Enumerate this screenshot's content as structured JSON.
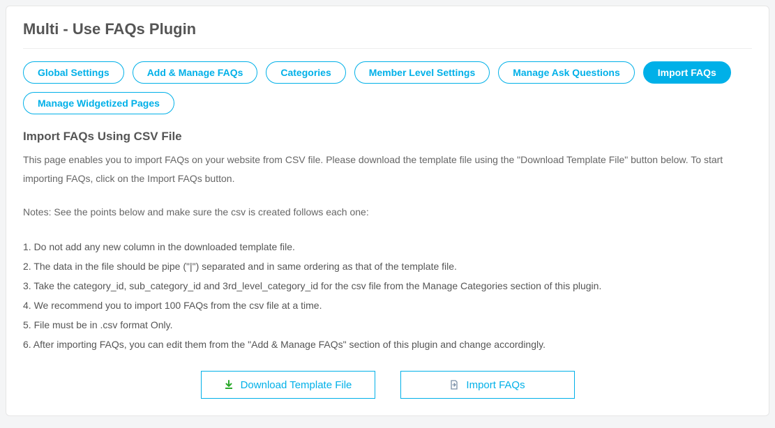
{
  "header": {
    "title": "Multi - Use FAQs Plugin"
  },
  "tabs": [
    {
      "label": "Global Settings",
      "active": false
    },
    {
      "label": "Add & Manage FAQs",
      "active": false
    },
    {
      "label": "Categories",
      "active": false
    },
    {
      "label": "Member Level Settings",
      "active": false
    },
    {
      "label": "Manage Ask Questions",
      "active": false
    },
    {
      "label": "Import FAQs",
      "active": true
    },
    {
      "label": "Manage Widgetized Pages",
      "active": false
    }
  ],
  "section": {
    "title": "Import FAQs Using CSV File",
    "description": "This page enables you to import FAQs on your website from CSV file. Please download the template file using the \"Download Template File\" button below. To start importing FAQs, click on the Import FAQs button.",
    "notes_intro": "Notes: See the points below and make sure the csv is created follows each one:",
    "points": [
      "Do not add any new column in the downloaded template file.",
      "The data in the file should be pipe (\"|\") separated and in same ordering as that of the template file.",
      "Take the category_id, sub_category_id and 3rd_level_category_id for the csv file from the Manage Categories section of this plugin.",
      "We recommend you to import 100 FAQs from the csv file at a time.",
      "File must be in .csv format Only.",
      "After importing FAQs, you can edit them from the \"Add & Manage FAQs\" section of this plugin and change accordingly."
    ]
  },
  "actions": {
    "download_label": "Download Template File",
    "import_label": "Import FAQs"
  },
  "colors": {
    "accent": "#00b0e8"
  }
}
